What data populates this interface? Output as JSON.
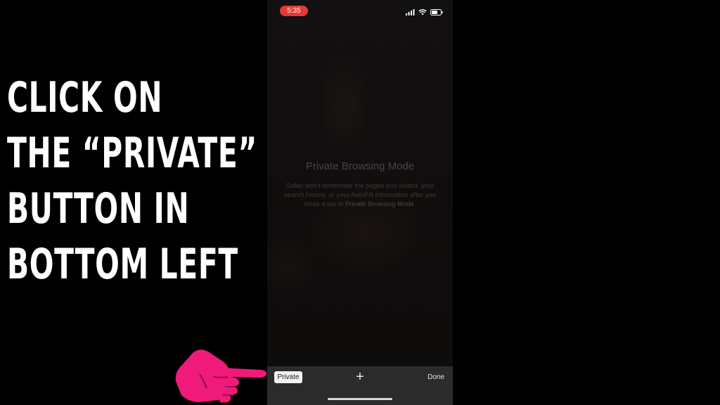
{
  "instruction": {
    "lines": [
      "CLICK ON",
      "THE  “PRIVATE”",
      "BUTTON IN",
      "BOTTOM LEFT"
    ]
  },
  "phone": {
    "status_time": "5:35",
    "status_icons": [
      "signal-icon",
      "wifi-icon",
      "battery-icon"
    ],
    "private_browsing": {
      "title": "Private Browsing Mode",
      "description_prefix": "Safari won't remember the pages you visited, your search history, or your AutoFill information after you close a tab in ",
      "description_link": "Private Browsing Mode",
      "description_suffix": "."
    },
    "toolbar": {
      "private_label": "Private",
      "plus_label": "+",
      "done_label": "Done"
    }
  },
  "colors": {
    "accent_hand": "#ef1a7a",
    "time_pill": "#e23b33",
    "toolbar": "#2b2b2b"
  },
  "icons": {
    "hand": "pointing-hand-icon"
  }
}
